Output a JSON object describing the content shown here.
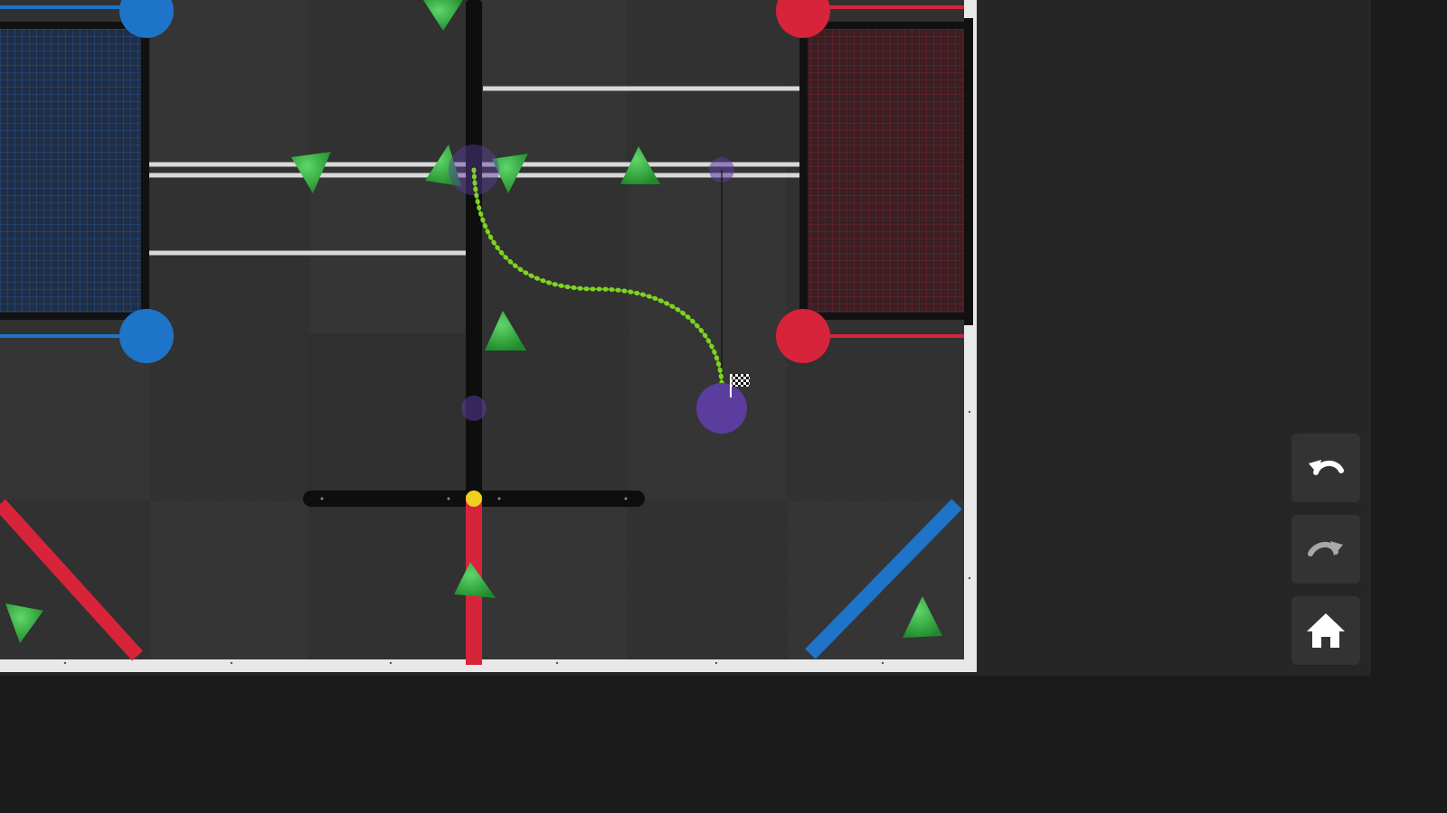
{
  "colors": {
    "page_bg": "#1b1b1b",
    "panel_bg": "#262626",
    "field_tile_dark": "#313131",
    "field_tile_light": "#363636",
    "path_green": "#7ed321",
    "waypoint_purple": "#5b3d9e",
    "alliance_red": "#d8243a",
    "alliance_blue": "#1e74c8",
    "triball_green": "#2fae3a",
    "button_bg": "#333333"
  },
  "toolbar": {
    "undo": {
      "icon": "undo-icon",
      "enabled": true
    },
    "redo": {
      "icon": "redo-icon",
      "enabled": false
    },
    "home": {
      "icon": "home-icon",
      "enabled": true
    }
  },
  "path": {
    "start_marker": "waypoint",
    "end_marker": "checkered-flag-icon"
  }
}
